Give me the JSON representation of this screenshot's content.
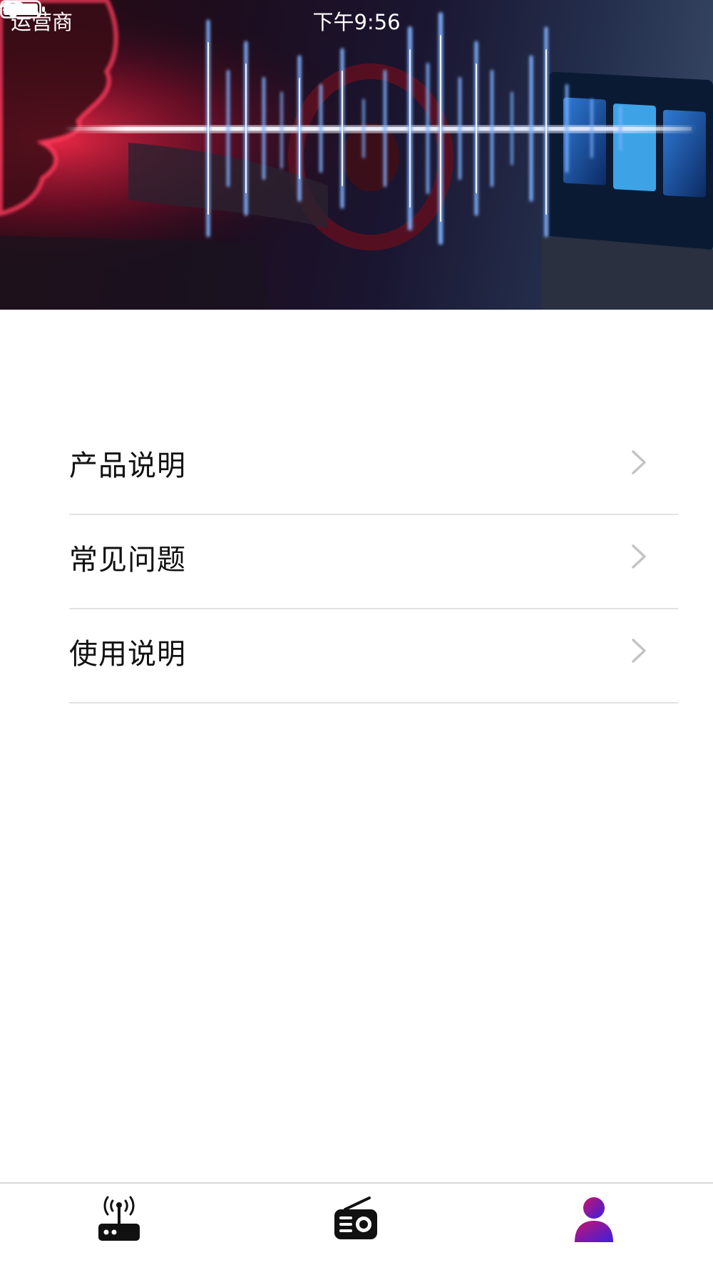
{
  "status_bar": {
    "carrier": "运营商",
    "time": "下午9:56",
    "wifi_icon": "wifi-icon",
    "battery_icon": "battery-icon",
    "text_color": "#ffffff"
  },
  "hero": {
    "image": "voice-sound-wave-car-interior-banner"
  },
  "menu": {
    "items": [
      {
        "label": "产品说明",
        "icon": "chevron-right-icon"
      },
      {
        "label": "常见问题",
        "icon": "chevron-right-icon"
      },
      {
        "label": "使用说明",
        "icon": "chevron-right-icon"
      }
    ]
  },
  "tab_bar": {
    "tabs": [
      {
        "icon": "router-icon",
        "selected": false
      },
      {
        "icon": "radio-icon",
        "selected": false
      },
      {
        "icon": "user-icon",
        "selected": true
      }
    ],
    "selected_gradient": [
      "#c8136e",
      "#3b1fe0"
    ]
  }
}
